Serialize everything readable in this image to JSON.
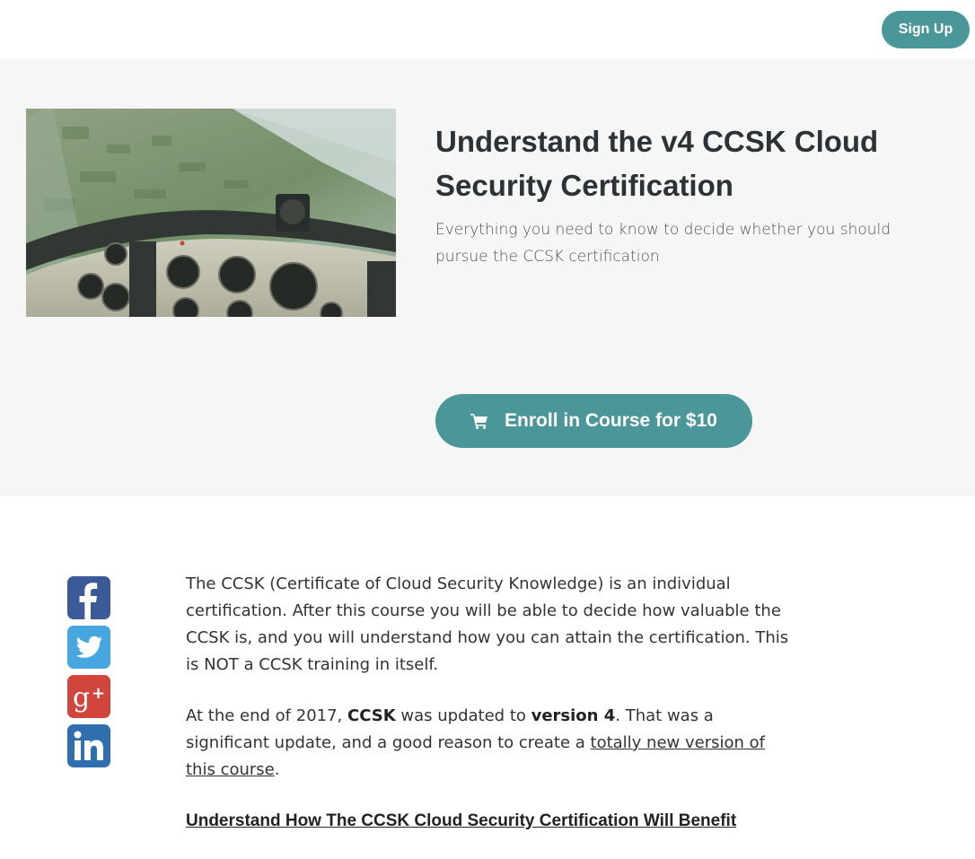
{
  "navbar": {
    "signup_label": "Sign Up"
  },
  "hero": {
    "title": "Understand the v4 CCSK Cloud Security Certification",
    "subtitle": "Everything you need to know to decide whether you should pursue the CCSK certification",
    "enroll_label": "Enroll in Course for $10",
    "enroll_icon": "cart-icon"
  },
  "social": [
    "facebook-icon",
    "twitter-icon",
    "google-plus-icon",
    "linkedin-icon"
  ],
  "colors": {
    "accent": "#4a9698",
    "hero_bg": "#f6f6f6"
  },
  "content": {
    "p1": "The CCSK (Certificate of Cloud Security Knowledge) is an individual certification. After this course you will be able to decide how valuable the CCSK is, and you will understand how you can attain the certification. This is NOT a CCSK training in itself.",
    "p2_part1": "At the end of 2017, ",
    "p2_bold1": "CCSK",
    "p2_part2": " was updated to ",
    "p2_bold2": "version 4",
    "p2_part3": ". That was a significant update, and a good reason to create a ",
    "p2_link": "totally new version of this course",
    "p2_part4": ".",
    "heading": "Understand How The CCSK Cloud Security Certification Will Benefit"
  }
}
